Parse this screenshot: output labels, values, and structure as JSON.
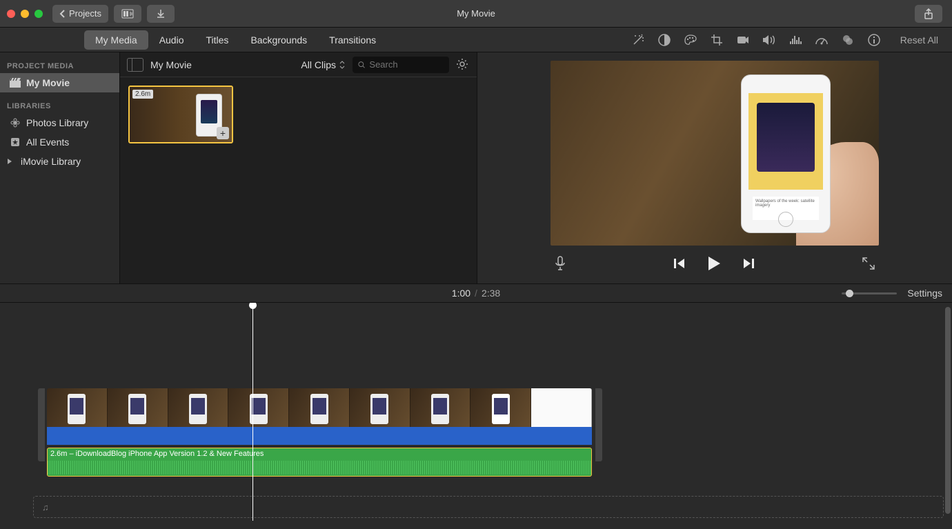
{
  "window": {
    "title": "My Movie"
  },
  "titlebar": {
    "back_label": "Projects"
  },
  "tabs": {
    "my_media": "My Media",
    "audio": "Audio",
    "titles": "Titles",
    "backgrounds": "Backgrounds",
    "transitions": "Transitions"
  },
  "sidebar": {
    "project_media_header": "PROJECT MEDIA",
    "my_movie": "My Movie",
    "libraries_header": "LIBRARIES",
    "photos_library": "Photos Library",
    "all_events": "All Events",
    "imovie_library": "iMovie Library"
  },
  "browser": {
    "project_name": "My Movie",
    "filter": "All Clips",
    "search_placeholder": "Search",
    "clip_duration": "2.6m",
    "clip_add": "+"
  },
  "preview": {
    "reset_all": "Reset All",
    "phone_caption": "Wallpapers of the week: satellite imagery"
  },
  "timecode": {
    "current": "1:00",
    "total": "2:38",
    "settings_label": "Settings"
  },
  "timeline": {
    "audio_label": "2.6m – iDownloadBlog iPhone App Version 1.2 & New Features",
    "music_icon": "♫"
  }
}
